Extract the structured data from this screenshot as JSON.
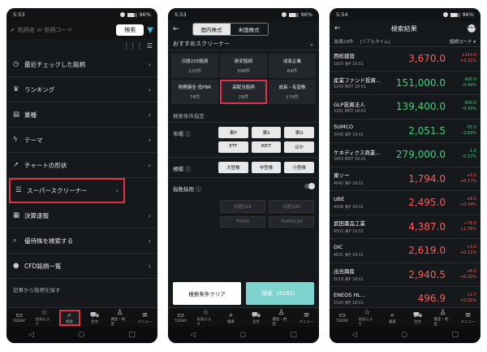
{
  "colors": {
    "up": "#ff5a5a",
    "down": "#3fd07a",
    "highlight": "#e0334a",
    "accent": "#7ed3cf"
  },
  "phone1": {
    "status": {
      "time": "5:53",
      "battery": "96%"
    },
    "search": {
      "placeholder": "銘柄名 or 銘柄コード",
      "button": "検索"
    },
    "menu": [
      {
        "icon": "clock-icon",
        "glyph": "◷",
        "label": "最近チェックした銘柄"
      },
      {
        "icon": "ranking-icon",
        "glyph": "♛",
        "label": "ランキング"
      },
      {
        "icon": "industry-icon",
        "glyph": "▤",
        "label": "業種"
      },
      {
        "icon": "lightning-icon",
        "glyph": "ϟ",
        "label": "テーマ"
      },
      {
        "icon": "chart-trend-icon",
        "glyph": "↗",
        "label": "チャートの形状"
      },
      {
        "icon": "screener-icon",
        "glyph": "☰",
        "label": "スーパースクリーナー"
      },
      {
        "icon": "report-icon",
        "glyph": "▦",
        "label": "決算速報"
      },
      {
        "icon": "search-icon",
        "glyph": "⌕",
        "label": "優待株を検索する"
      },
      {
        "icon": "cfd-icon",
        "glyph": "●",
        "label": "CFD銘柄一覧"
      }
    ],
    "footer_note": "記事から銘柄を探す"
  },
  "nav": [
    {
      "icon": "home-icon",
      "glyph": "▭",
      "label": "TODAY"
    },
    {
      "icon": "star-icon",
      "glyph": "☆",
      "label": "お気に入り"
    },
    {
      "icon": "search-icon",
      "glyph": "⌕",
      "label": "検索"
    },
    {
      "icon": "cart-icon",
      "glyph": "⛟",
      "label": "注文"
    },
    {
      "icon": "user-icon",
      "glyph": "♙",
      "label": "資産・約定"
    },
    {
      "icon": "menu-icon",
      "glyph": "≡",
      "label": "メニュー"
    }
  ],
  "phone2": {
    "status": {
      "time": "5:53",
      "battery": "96%"
    },
    "tabs": [
      "国内株式",
      "米国株式"
    ],
    "section_title": "おすすめスクリーナー",
    "screeners": [
      {
        "name": "日経225銘柄",
        "count": "225件"
      },
      {
        "name": "新安銘柄",
        "count": "398件"
      },
      {
        "name": "成長企業",
        "count": "64件"
      },
      {
        "name": "財務健全 低PBR",
        "count": "74件"
      },
      {
        "name": "高配当銘柄",
        "count": "29件"
      },
      {
        "name": "成長・有望株",
        "count": "174件"
      }
    ],
    "cond_title": "検索条件指定",
    "market_label": "市場",
    "markets": [
      "東P",
      "東S",
      "東G",
      "ETF",
      "REIT",
      "ほか"
    ],
    "scale_label": "規模",
    "scales": [
      "大型株",
      "中型株",
      "小型株"
    ],
    "index_label": "指数採用",
    "indexes": [
      "日経225",
      "日経300",
      "TOPIX",
      "TOPIX100"
    ],
    "clear_button": "検索条件クリア",
    "search_button": "検索（4282）"
  },
  "phone3": {
    "status": {
      "time": "5:54",
      "battery": "96%"
    },
    "title": "検索結果",
    "count": "結果29件",
    "mode": "[リアルタイム]",
    "sort": "銘柄コード ▾",
    "results": [
      {
        "name": "西松建設",
        "code": "1820 東P 18:01",
        "price": "3,670.0",
        "chg": "+114.0",
        "pct": "+3.21%",
        "dir": "up"
      },
      {
        "name": "産業ファンド投資...",
        "code": "3249 REIT 18:01",
        "price": "151,000.0",
        "chg": "-600.0",
        "pct": "-0.40%",
        "dir": "down"
      },
      {
        "name": "GLP投資法人",
        "code": "3281 REIT 18:01",
        "price": "139,400.0",
        "chg": "-600.0",
        "pct": "-0.43%",
        "dir": "down"
      },
      {
        "name": "SUMCO",
        "code": "3436 東P 18:01",
        "price": "2,051.5",
        "chg": "-55.5",
        "pct": "-2.63%",
        "dir": "down"
      },
      {
        "name": "ケネディクス商業...",
        "code": "3453 REIT 18:01",
        "price": "279,000.0",
        "chg": "-1.0",
        "pct": "-0.57%",
        "dir": "down"
      },
      {
        "name": "東ソー",
        "code": "4042 東P 18:01",
        "price": "1,794.0",
        "chg": "+3.0",
        "pct": "+0.17%",
        "dir": "up"
      },
      {
        "name": "UBE",
        "code": "4208 東P 18:01",
        "price": "2,495.0",
        "chg": "+8.5",
        "pct": "+0.34%",
        "dir": "up"
      },
      {
        "name": "武田薬品工業",
        "code": "4502 東P 18:01",
        "price": "4,387.0",
        "chg": "+76.0",
        "pct": "+1.76%",
        "dir": "up"
      },
      {
        "name": "DIC",
        "code": "4631 東P 18:01",
        "price": "2,619.0",
        "chg": "+3.0",
        "pct": "+0.11%",
        "dir": "up"
      },
      {
        "name": "出光興産",
        "code": "5019 東P 18:01",
        "price": "2,940.5",
        "chg": "+6.0",
        "pct": "+0.20%",
        "dir": "up"
      },
      {
        "name": "ENEOS HL...",
        "code": "5020 東P 18:01",
        "price": "496.9",
        "chg": "+2.7",
        "pct": "+0.55%",
        "dir": "up"
      }
    ]
  }
}
